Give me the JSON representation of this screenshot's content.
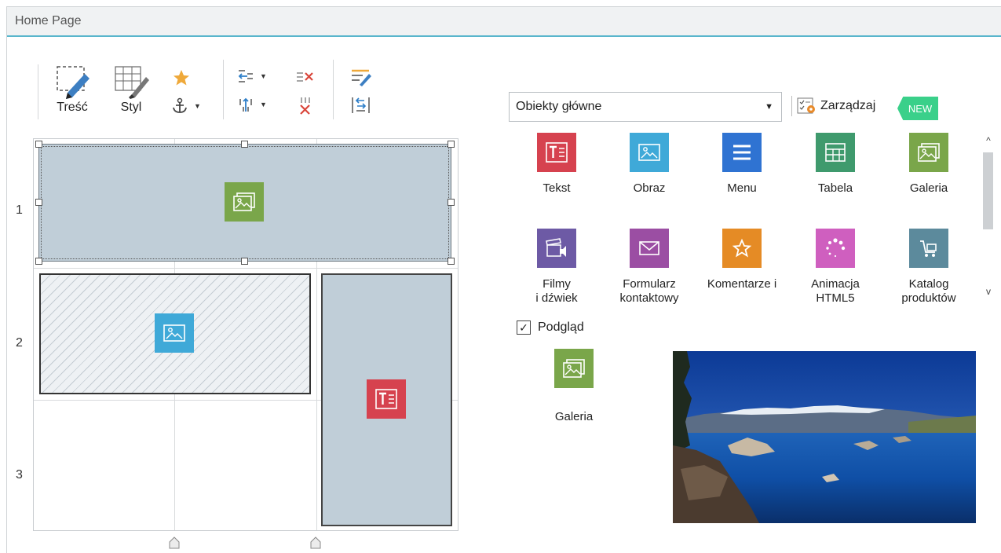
{
  "window": {
    "title": "Home Page"
  },
  "toolbar": {
    "content_label": "Treść",
    "style_label": "Styl"
  },
  "grid": {
    "rows": [
      "1",
      "2",
      "3"
    ]
  },
  "panel": {
    "category_value": "Obiekty główne",
    "manage_label": "Zarządzaj",
    "new_badge": "NEW",
    "objects": [
      {
        "label": "Tekst",
        "icon": "text-icon",
        "color": "#d6424f"
      },
      {
        "label": "Obraz",
        "icon": "image-icon",
        "color": "#3fa9d8"
      },
      {
        "label": "Menu",
        "icon": "menu-icon",
        "color": "#2f73d2"
      },
      {
        "label": "Tabela",
        "icon": "table-icon",
        "color": "#3f9a6d"
      },
      {
        "label": "Galeria",
        "icon": "gallery-icon",
        "color": "#7aa64a"
      },
      {
        "label": "Filmy\ni dźwiek",
        "icon": "film-sound-icon",
        "color": "#6d5aa5"
      },
      {
        "label": "Formularz\nkontaktowy",
        "icon": "envelope-icon",
        "color": "#9b4ea3"
      },
      {
        "label": "Komentarze i",
        "icon": "star-comment-icon",
        "color": "#e58b25"
      },
      {
        "label": "Animacja\nHTML5",
        "icon": "spinner-icon",
        "color": "#cf5fbf"
      },
      {
        "label": "Katalog\nproduktów",
        "icon": "cart-icon",
        "color": "#5c8a9c"
      }
    ],
    "preview_label": "Podgląd",
    "preview_checked": true,
    "preview_item_label": "Galeria"
  }
}
